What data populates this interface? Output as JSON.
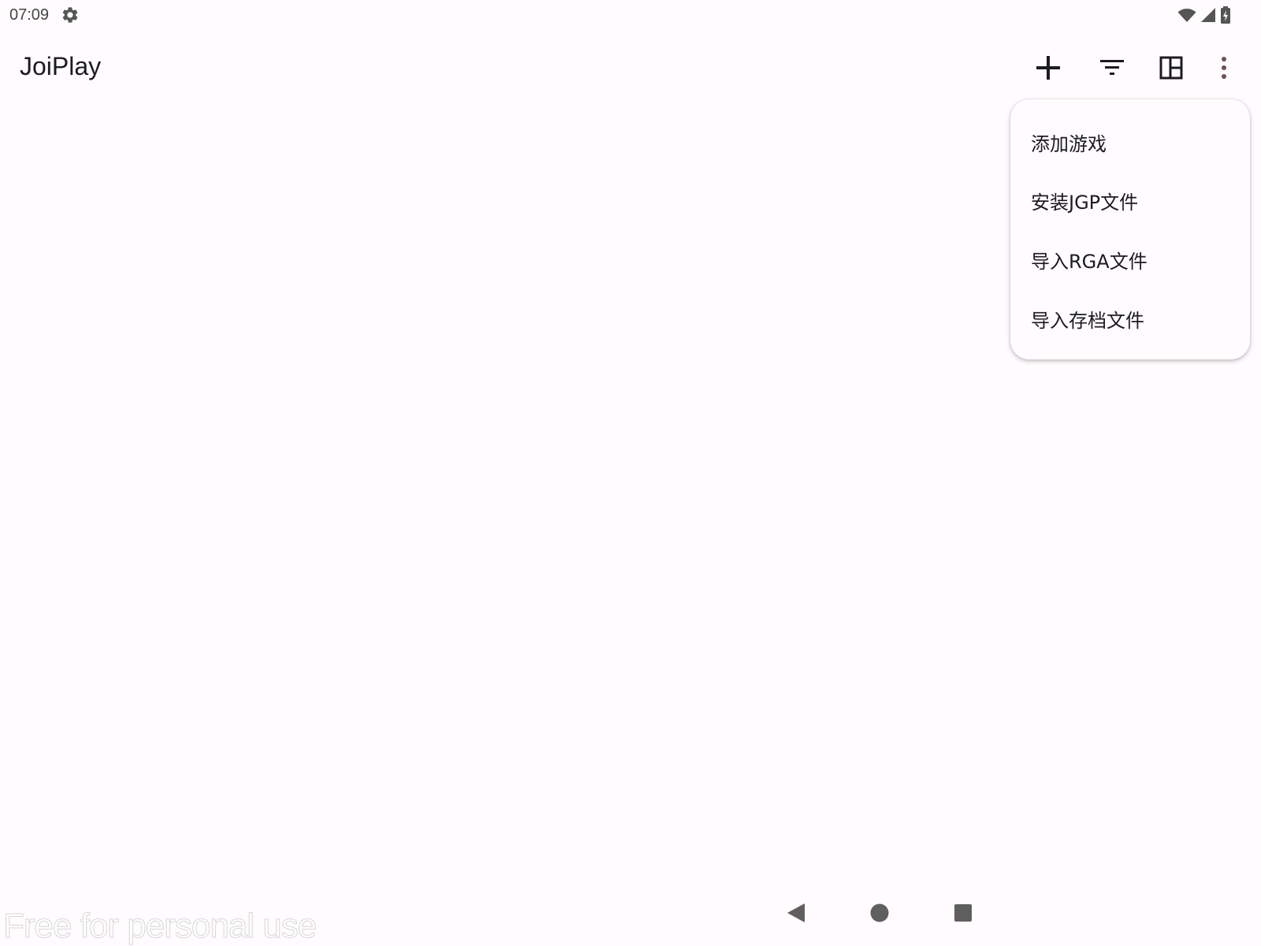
{
  "status_bar": {
    "time": "07:09",
    "icons": [
      "settings-icon",
      "wifi-icon",
      "cellular-signal-icon",
      "battery-charging-icon"
    ]
  },
  "toolbar": {
    "title": "JoiPlay",
    "actions": [
      "add-icon",
      "filter-icon",
      "layout-icon",
      "more-vert-icon"
    ]
  },
  "popup_menu": {
    "items": [
      {
        "label": "添加游戏"
      },
      {
        "label": "安装JGP文件"
      },
      {
        "label": "导入RGA文件"
      },
      {
        "label": "导入存档文件"
      }
    ]
  },
  "navigation_bar": {
    "buttons": [
      "back-icon",
      "home-icon",
      "recents-icon"
    ]
  },
  "watermark": {
    "text": "Free for personal use"
  },
  "colors": {
    "background": "#fffbfe",
    "text_primary": "#1c1b1f",
    "icon": "#1c1b1f",
    "nav_icon": "#5f5f5f"
  }
}
